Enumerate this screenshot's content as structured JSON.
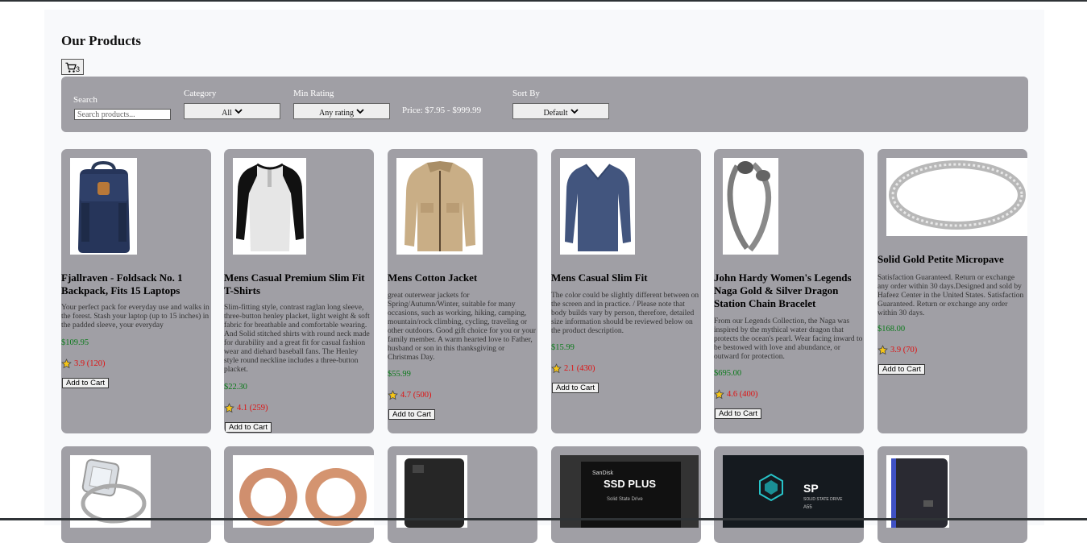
{
  "page": {
    "title": "Our Products"
  },
  "cart": {
    "count": "3"
  },
  "filters": {
    "search_label": "Search",
    "search_placeholder": "Search products...",
    "category_label": "Category",
    "category_value": "All",
    "rating_label": "Min Rating",
    "rating_value": "Any rating",
    "price_range": "Price: $7.95 - $999.99",
    "sort_label": "Sort By",
    "sort_value": "Default"
  },
  "add_to_cart_label": "Add to Cart",
  "products": [
    {
      "name": "Fjallraven - Foldsack No. 1 Backpack, Fits 15 Laptops",
      "description": "Your perfect pack for everyday use and walks in the forest. Stash your laptop (up to 15 inches) in the padded sleeve, your everyday",
      "price": "$109.95",
      "rating": "3.9 (120)",
      "image_icon": "backpack-icon"
    },
    {
      "name": "Mens Casual Premium Slim Fit T-Shirts",
      "description": "Slim-fitting style, contrast raglan long sleeve, three-button henley placket, light weight & soft fabric for breathable and comfortable wearing. And Solid stitched shirts with round neck made for durability and a great fit for casual fashion wear and diehard baseball fans. The Henley style round neckline includes a three-button placket.",
      "price": "$22.30",
      "rating": "4.1 (259)",
      "image_icon": "tshirt-icon"
    },
    {
      "name": "Mens Cotton Jacket",
      "description": "great outerwear jackets for Spring/Autumn/Winter, suitable for many occasions, such as working, hiking, camping, mountain/rock climbing, cycling, traveling or other outdoors. Good gift choice for you or your family member. A warm hearted love to Father, husband or son in this thanksgiving or Christmas Day.",
      "price": "$55.99",
      "rating": "4.7 (500)",
      "image_icon": "jacket-icon"
    },
    {
      "name": "Mens Casual Slim Fit",
      "description": "The color could be slightly different between on the screen and in practice. / Please note that body builds vary by person, therefore, detailed size information should be reviewed below on the product description.",
      "price": "$15.99",
      "rating": "2.1 (430)",
      "image_icon": "longsleeve-shirt-icon"
    },
    {
      "name": "John Hardy Women's Legends Naga Gold & Silver Dragon Station Chain Bracelet",
      "description": "From our Legends Collection, the Naga was inspired by the mythical water dragon that protects the ocean's pearl. Wear facing inward to be bestowed with love and abundance, or outward for protection.",
      "price": "$695.00",
      "rating": "4.6 (400)",
      "image_icon": "bracelet-icon"
    },
    {
      "name": "Solid Gold Petite Micropave",
      "description": "Satisfaction Guaranteed. Return or exchange any order within 30 days.Designed and sold by Hafeez Center in the United States. Satisfaction Guaranteed. Return or exchange any order within 30 days.",
      "price": "$168.00",
      "rating": "3.9 (70)",
      "image_icon": "ring-icon"
    }
  ],
  "products_row2": [
    {
      "image_icon": "diamond-ring-icon"
    },
    {
      "image_icon": "rose-gold-plugs-icon"
    },
    {
      "image_icon": "hard-drive-icon"
    },
    {
      "image_icon": "ssd-icon",
      "image_text": "SSD PLUS",
      "image_subtext": "Solid State Drive",
      "image_brand": "SanDisk"
    },
    {
      "image_icon": "ssd-icon",
      "image_text": "SP",
      "image_subtext": "SOLID STATE DRIVE",
      "image_brand": "A55"
    },
    {
      "image_icon": "portable-drive-icon"
    }
  ]
}
